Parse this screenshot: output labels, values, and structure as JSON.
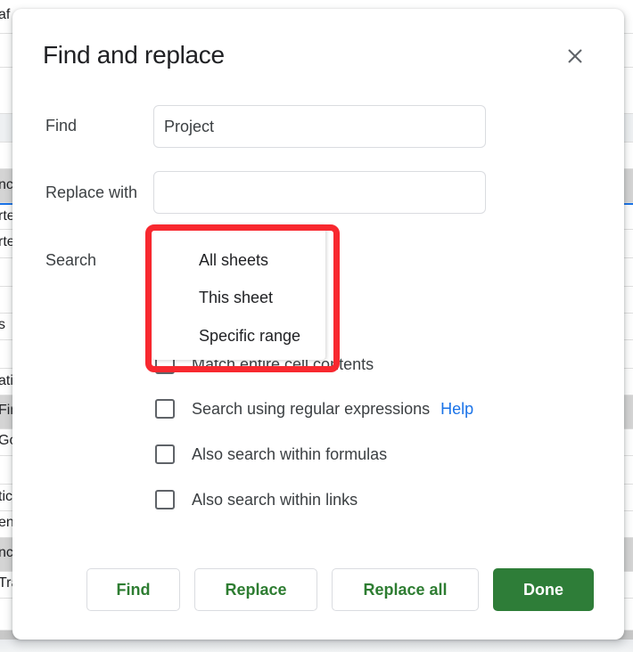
{
  "background_sheet": {
    "rows": [
      {
        "text": "af",
        "style": "plain"
      },
      {
        "text": "",
        "style": "plain"
      },
      {
        "text": "",
        "style": "plain"
      },
      {
        "text": "",
        "style": "light"
      },
      {
        "text": "",
        "style": "plain"
      },
      {
        "text": "nc",
        "style": "gray"
      },
      {
        "text": "rte",
        "style": "selected"
      },
      {
        "text": "rte",
        "style": "plain"
      },
      {
        "text": "",
        "style": "plain"
      },
      {
        "text": "",
        "style": "plain"
      },
      {
        "text": "s",
        "style": "plain"
      },
      {
        "text": "",
        "style": "plain"
      },
      {
        "text": "ati",
        "style": "plain"
      },
      {
        "text": "Fin",
        "style": "gray"
      },
      {
        "text": "Go",
        "style": "plain"
      },
      {
        "text": "",
        "style": "plain"
      },
      {
        "text": "tic",
        "style": "plain"
      },
      {
        "text": "en",
        "style": "plain"
      },
      {
        "text": "nc",
        "style": "gray"
      },
      {
        "text": "Tra",
        "style": "plain"
      },
      {
        "text": "",
        "style": "plain"
      }
    ]
  },
  "dialog": {
    "title": "Find and replace",
    "close_icon": "close-icon",
    "find": {
      "label": "Find",
      "value": "Project",
      "placeholder": ""
    },
    "replace": {
      "label": "Replace with",
      "value": "",
      "placeholder": ""
    },
    "search": {
      "label": "Search",
      "options": [
        "All sheets",
        "This sheet",
        "Specific range"
      ]
    },
    "checkboxes": [
      {
        "label": "Match entire cell contents",
        "checked": false
      },
      {
        "label": "Search using regular expressions",
        "checked": false,
        "link": "Help"
      },
      {
        "label": "Also search within formulas",
        "checked": false
      },
      {
        "label": "Also search within links",
        "checked": false
      }
    ],
    "buttons": {
      "find": "Find",
      "replace": "Replace",
      "replace_all": "Replace all",
      "done": "Done"
    }
  },
  "colors": {
    "accent_green": "#2e7d38",
    "link_blue": "#1a73e8",
    "highlight_red": "#f8282f"
  }
}
